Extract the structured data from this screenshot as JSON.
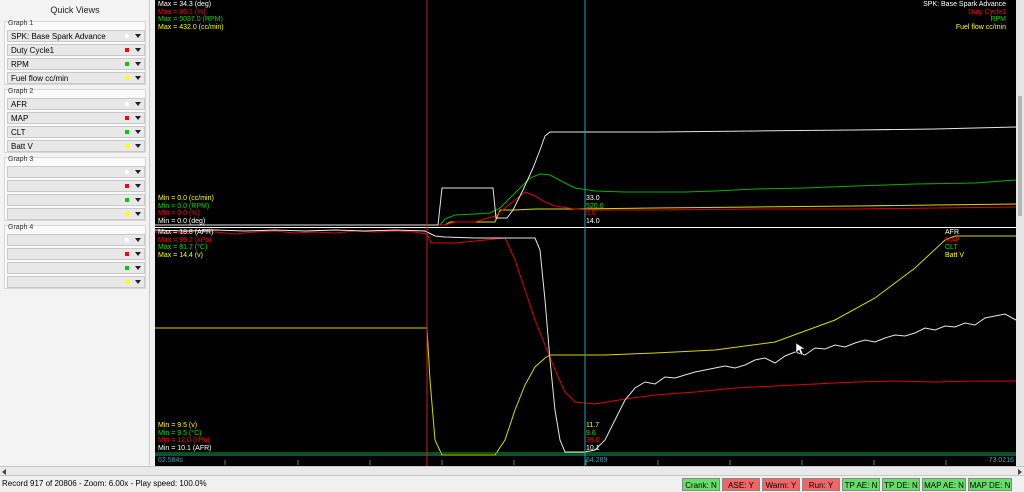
{
  "sidebar": {
    "title": "Quick Views",
    "groups": [
      {
        "label": "Graph 1",
        "rows": [
          {
            "label": "SPK: Base Spark Advance",
            "color": "#ffffff"
          },
          {
            "label": "Duty Cycle1",
            "color": "#ff0000"
          },
          {
            "label": "RPM",
            "color": "#00cc00"
          },
          {
            "label": "Fuel flow cc/min",
            "color": "#ffff00"
          }
        ]
      },
      {
        "label": "Graph 2",
        "rows": [
          {
            "label": "AFR",
            "color": "#ffffff"
          },
          {
            "label": "MAP",
            "color": "#ff0000"
          },
          {
            "label": "CLT",
            "color": "#00cc00"
          },
          {
            "label": "Batt V",
            "color": "#ffff00"
          }
        ]
      },
      {
        "label": "Graph 3",
        "rows": [
          {
            "label": "",
            "color": "#ffffff"
          },
          {
            "label": "",
            "color": "#ff0000"
          },
          {
            "label": "",
            "color": "#00cc00"
          },
          {
            "label": "",
            "color": "#ffff00"
          }
        ]
      },
      {
        "label": "Graph 4",
        "rows": [
          {
            "label": "",
            "color": "#ffffff"
          },
          {
            "label": "",
            "color": "#ff0000"
          },
          {
            "label": "",
            "color": "#00cc00"
          },
          {
            "label": "",
            "color": "#ffff00"
          }
        ]
      }
    ]
  },
  "graph1": {
    "max_labels": [
      {
        "text": "Max = 34.3 (deg)",
        "color": "#ffffff"
      },
      {
        "text": "Max = 86.1 (%)",
        "color": "#ff0000"
      },
      {
        "text": "Max = 5037.0 (RPM)",
        "color": "#00dd00"
      },
      {
        "text": "Max = 432.0 (cc/min)",
        "color": "#ffff00"
      }
    ],
    "min_labels": [
      {
        "text": "Min = 0.0 (cc/min)",
        "color": "#ffff00"
      },
      {
        "text": "Min = 0.0 (RPM)",
        "color": "#00dd00"
      },
      {
        "text": "Min = 0.0 (%)",
        "color": "#ff0000"
      },
      {
        "text": "Min = 0.0 (deg)",
        "color": "#ffffff"
      }
    ],
    "legend": [
      {
        "text": "SPK: Base Spark Advance",
        "color": "#ffffff"
      },
      {
        "text": "Duty Cycle1",
        "color": "#ff0000"
      },
      {
        "text": "RPM",
        "color": "#00dd00"
      },
      {
        "text": "Fuel flow cc/min",
        "color": "#ffff00"
      }
    ],
    "cursor_values": [
      {
        "text": "33.0",
        "color": "#ffffff"
      },
      {
        "text": "520.0",
        "color": "#00dd00"
      },
      {
        "text": "5.0",
        "color": "#ff0000"
      },
      {
        "text": "14.0",
        "color": "#ffffff"
      }
    ]
  },
  "graph2": {
    "max_labels": [
      {
        "text": "Max = 18.8 (AFR)",
        "color": "#ffffff"
      },
      {
        "text": "Max = 99.2 (kPa)",
        "color": "#ff0000"
      },
      {
        "text": "Max = 81.7 (°C)",
        "color": "#00dd00"
      },
      {
        "text": "Max = 14.4 (v)",
        "color": "#ffff00"
      }
    ],
    "min_labels": [
      {
        "text": "Min = 9.5 (v)",
        "color": "#ffff00"
      },
      {
        "text": "Min = 9.5 (°C)",
        "color": "#00dd00"
      },
      {
        "text": "Min = 12.0 (kPa)",
        "color": "#ff0000"
      },
      {
        "text": "Min = 10.1 (AFR)",
        "color": "#ffffff"
      }
    ],
    "legend": [
      {
        "text": "AFR",
        "color": "#ffffff"
      },
      {
        "text": "MAP",
        "color": "#ff0000"
      },
      {
        "text": "CLT",
        "color": "#00dd00"
      },
      {
        "text": "Batt V",
        "color": "#ffff00"
      }
    ],
    "cursor_values": [
      {
        "text": "11.7",
        "color": "#ffff00"
      },
      {
        "text": "9.6",
        "color": "#00dd00"
      },
      {
        "text": "39.0",
        "color": "#ff0000"
      },
      {
        "text": "10.1",
        "color": "#ffffff"
      }
    ]
  },
  "timeline": {
    "start": "62.584s",
    "cursor": "64.289",
    "end": "73.0216"
  },
  "status": {
    "text": "Record 917 of 20806 - Zoom: 6.00x - Play speed: 100.0%"
  },
  "indicators": [
    {
      "label": "Crank: N",
      "color": "#66dd66"
    },
    {
      "label": "ASE: Y",
      "color": "#ee6666"
    },
    {
      "label": "Warm: Y",
      "color": "#ee6666"
    },
    {
      "label": "Run: Y",
      "color": "#ee6666"
    },
    {
      "label": "TP AE: N",
      "color": "#66dd66"
    },
    {
      "label": "TP DE: N",
      "color": "#66dd66"
    },
    {
      "label": "MAP AE: N",
      "color": "#66dd66"
    },
    {
      "label": "MAP DE: N",
      "color": "#66dd66"
    }
  ]
}
